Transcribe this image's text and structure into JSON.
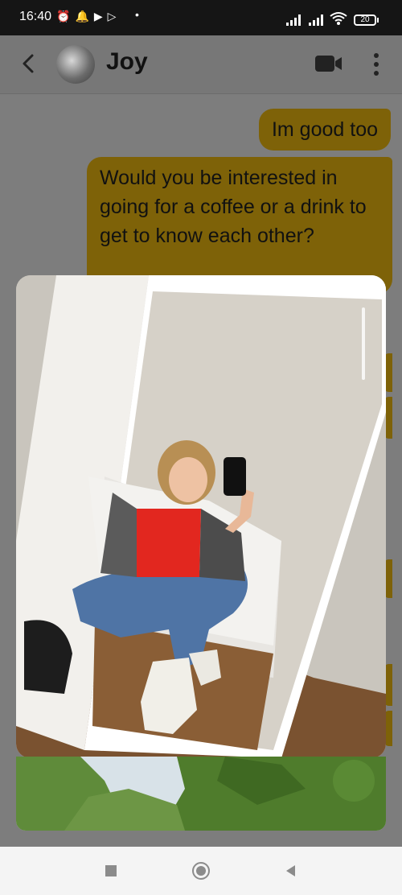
{
  "status_bar": {
    "time": "16:40",
    "battery": "20",
    "icons": [
      "alarm-icon",
      "notification-bell-icon",
      "youtube-icon",
      "play-store-icon",
      "signal-icon",
      "signal-icon",
      "wifi-icon",
      "battery-icon"
    ]
  },
  "header": {
    "contact_name": "Joy",
    "icons": [
      "back-icon",
      "video-call-icon",
      "more-options-icon"
    ]
  },
  "messages": [
    {
      "sender": "me",
      "text": "Im good too"
    },
    {
      "sender": "me",
      "text": "Would you be interested in going for a coffee or a drink to get to know each other?"
    }
  ],
  "colors": {
    "bubble": "#7e6208",
    "header": "#777777",
    "status_bar": "#151515",
    "nav_bar": "#f4f4f4"
  },
  "nav_bar": {
    "icons": [
      "recent-apps-icon",
      "home-icon",
      "back-nav-icon"
    ]
  }
}
